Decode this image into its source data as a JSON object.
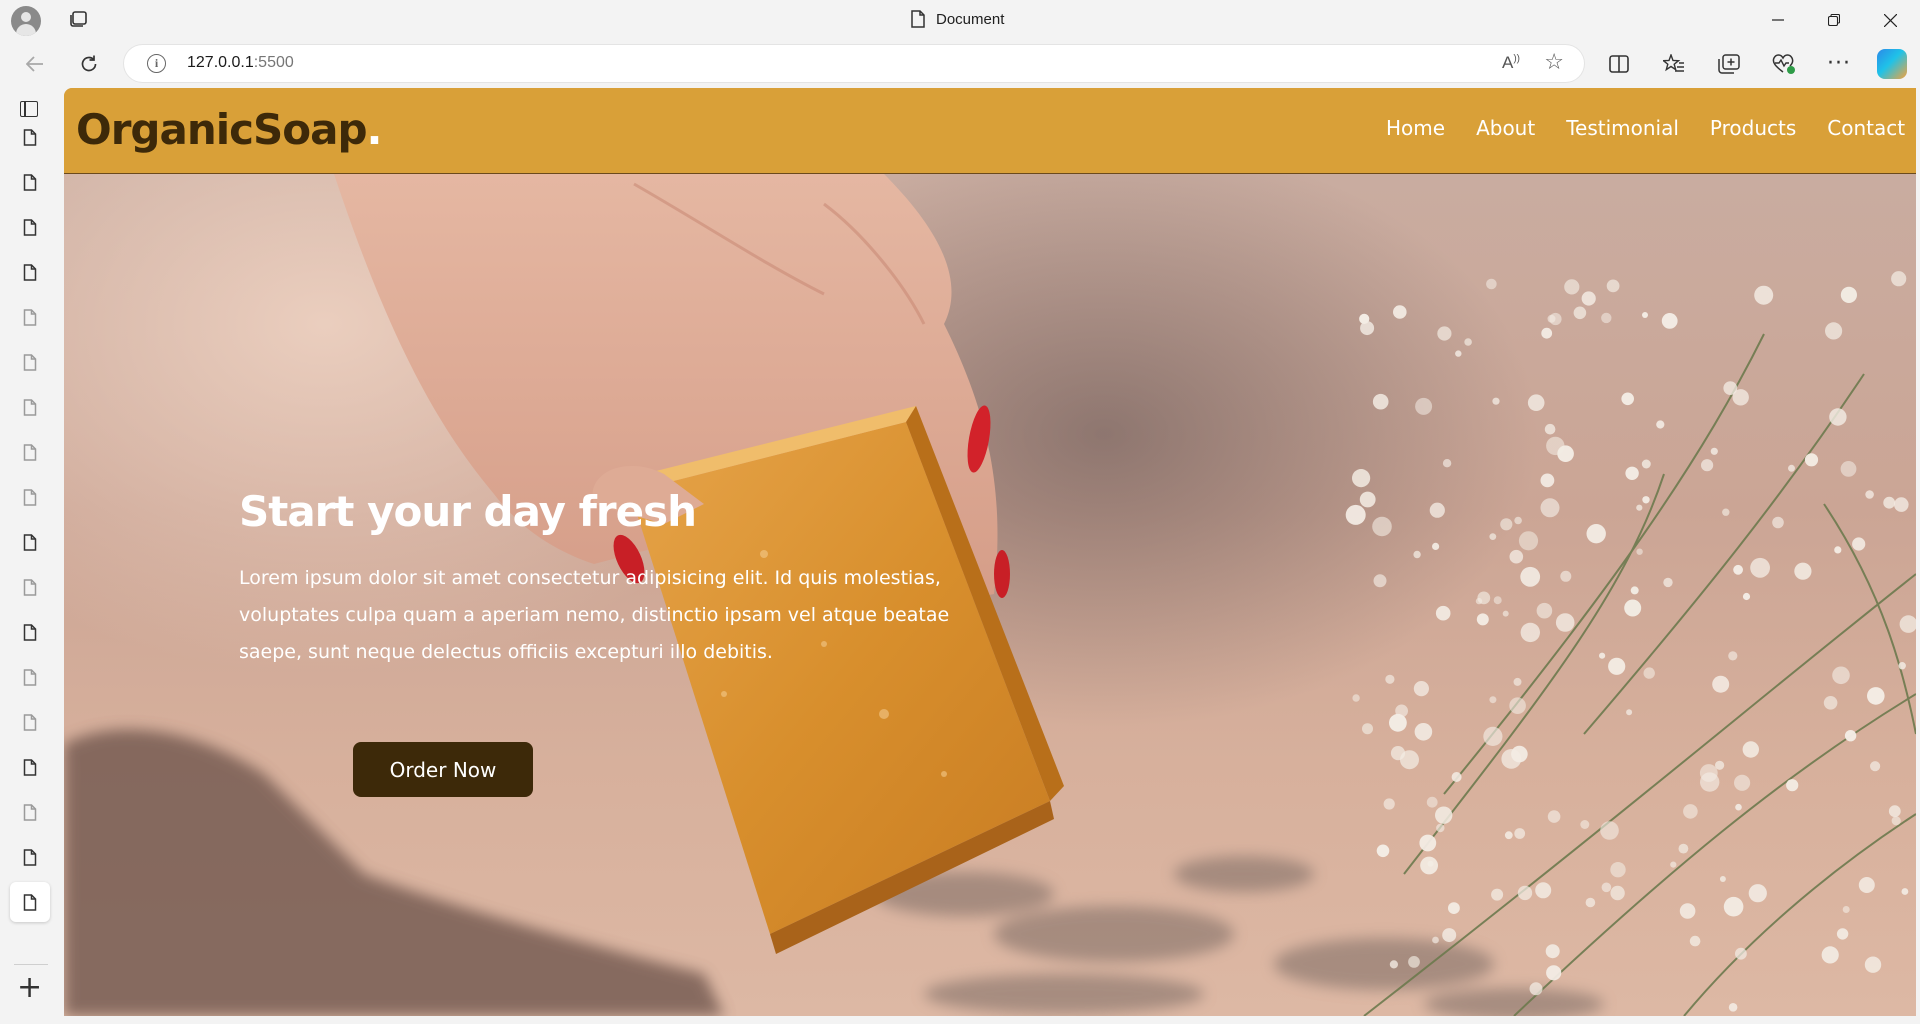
{
  "browser": {
    "window_title": "Document",
    "url_host": "127.0.0.1",
    "url_port": ":5500"
  },
  "site": {
    "logo_text": "OrganicSoap",
    "logo_dot": ".",
    "nav": [
      "Home",
      "About",
      "Testimonial",
      "Products",
      "Contact"
    ],
    "hero_title": "Start your day fresh",
    "hero_description": "Lorem ipsum dolor sit amet consectetur adipisicing elit. Id quis molestias, voluptates culpa quam a aperiam nemo, distinctio ipsam vel atque beatae saepe, sunt neque delectus officiis excepturi illo debitis.",
    "cta_label": "Order Now"
  },
  "colors": {
    "header_bg": "#d9a038",
    "logo_text": "#3d2909",
    "button_bg": "#3d2909",
    "soap": "#d68f2c"
  }
}
